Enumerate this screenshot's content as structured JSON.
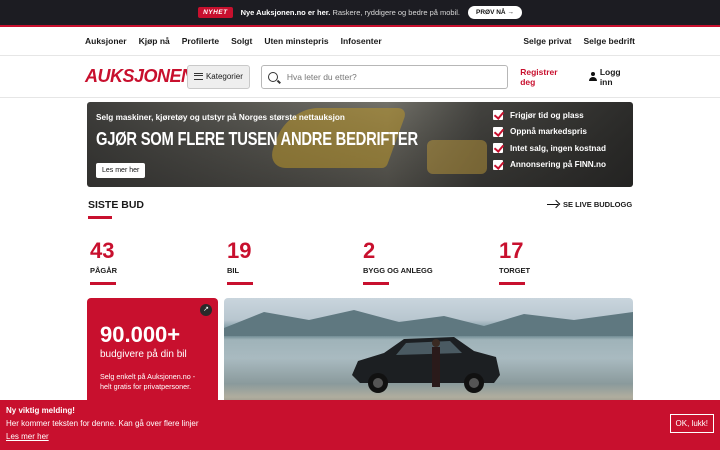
{
  "topbar": {
    "tag": "NYHET",
    "title": "Nye Auksjonen.no er her.",
    "text": "Raskere, ryddigere og bedre på mobil.",
    "button": "PRØV NÅ →"
  },
  "nav": {
    "left": [
      "Auksjoner",
      "Kjøp nå",
      "Profilerte",
      "Solgt",
      "Uten minstepris",
      "Infosenter"
    ],
    "right": [
      "Selge privat",
      "Selge bedrift"
    ]
  },
  "header": {
    "logo": "AUKSJONEN",
    "categories": "Kategorier",
    "search_placeholder": "Hva leter du etter?",
    "register": "Registrer deg",
    "login": "Logg inn"
  },
  "banner": {
    "subtitle": "Selg maskiner, kjøretøy og utstyr på Norges største nettauksjon",
    "headline": "GJØR SOM FLERE TUSEN ANDRE BEDRIFTER",
    "button": "Les mer her",
    "checks": [
      "Frigjør tid og plass",
      "Oppnå markedspris",
      "Intet salg, ingen kostnad",
      "Annonsering på FINN.no"
    ]
  },
  "siste_bud": {
    "title": "SISTE BUD",
    "live_link": "SE LIVE BUDLOGG",
    "stats": [
      {
        "num": "43",
        "label": "PÅGÅR"
      },
      {
        "num": "19",
        "label": "BIL"
      },
      {
        "num": "2",
        "label": "BYGG OG ANLEGG"
      },
      {
        "num": "17",
        "label": "TORGET"
      }
    ]
  },
  "promo": {
    "corner": "↗",
    "big": "90.000+",
    "sub": "budgivere på din bil",
    "small": "Selg enkelt på Auksjonen.no - helt gratis for privatpersoner."
  },
  "notice": {
    "title": "Ny viktig melding!",
    "text": "Her kommer teksten for denne. Kan gå over flere linjer",
    "link": "Les mer her",
    "ok": "OK, lukk!"
  },
  "colors": {
    "accent": "#c8102e",
    "dark": "#1c1c22"
  }
}
